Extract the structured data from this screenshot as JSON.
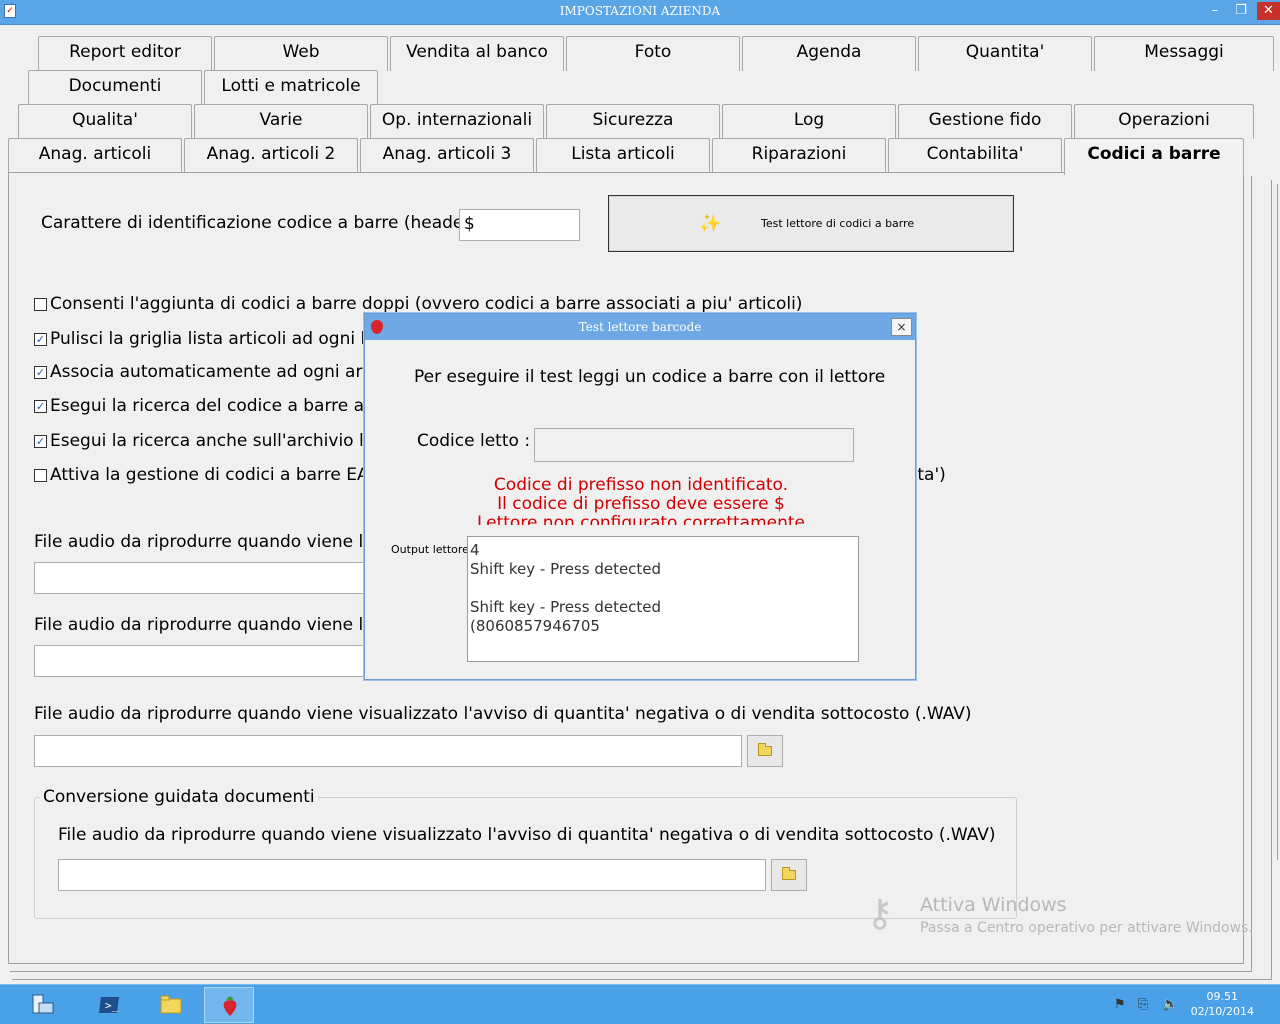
{
  "window": {
    "title": "IMPOSTAZIONI AZIENDA"
  },
  "tabs_row1": [
    "Report editor",
    "Web",
    "Vendita al banco",
    "Foto",
    "Agenda",
    "Quantita'",
    "Messaggi"
  ],
  "tabs_row2": [
    "Documenti",
    "Lotti e matricole"
  ],
  "tabs_row3": [
    "Qualita'",
    "Varie",
    "Op. internazionali",
    "Sicurezza",
    "Log",
    "Gestione fido",
    "Operazioni"
  ],
  "tabs_row4": [
    "Anag. articoli",
    "Anag. articoli 2",
    "Anag. articoli 3",
    "Lista articoli",
    "Riparazioni",
    "Contabilita'",
    "Codici a barre"
  ],
  "header_char": {
    "label": "Carattere di identificazione codice a barre (header) :",
    "value": "$"
  },
  "test_button": {
    "label": "Test lettore di codici a barre"
  },
  "checkboxes": [
    {
      "label": "Consenti l'aggiunta di codici a barre doppi (ovvero codici a barre associati a piu' articoli)",
      "checked": false
    },
    {
      "label": "Pulisci la griglia lista articoli ad ogni lettu",
      "checked": true
    },
    {
      "label": "Associa automaticamente ad ogni artico",
      "checked": true
    },
    {
      "label": "Esegui la ricerca del codice a barre anch",
      "checked": true
    },
    {
      "label": "Esegui la ricerca anche sull'archivio lotti/",
      "checked": true
    },
    {
      "label": "Attiva la gestione di codici a barre EAN c",
      "checked": false
    }
  ],
  "checkbox6_tail": "tita')",
  "audio1": {
    "label": "File audio da riprodurre quando viene letto",
    "value": ""
  },
  "audio2": {
    "label": "File audio da riprodurre quando viene letto",
    "value": ""
  },
  "audio3": {
    "label": "File audio da riprodurre quando viene visualizzato l'avviso di quantita' negativa o di vendita sottocosto (.WAV)",
    "value": ""
  },
  "group": {
    "title": "Conversione guidata documenti",
    "audio_label": "File audio da riprodurre quando viene visualizzato l'avviso di quantita' negativa o di vendita sottocosto (.WAV)",
    "audio_value": ""
  },
  "dialog": {
    "title": "Test lettore barcode",
    "close": "×",
    "instruction": "Per eseguire il test leggi un codice a barre con il lettore",
    "code_label": "Codice letto :",
    "code_value": "",
    "error1": "Codice di prefisso non identificato.",
    "error2": "Il codice di prefisso deve essere $",
    "error3": "Lettore non configurato correttamente",
    "output_label": "Output lettore :",
    "output_text": "4\nShift key - Press detected\n\nShift key - Press detected\n(8060857946705\n"
  },
  "watermark": {
    "line1": "Attiva Windows",
    "line2": "Passa a Centro operativo per attivare Windows."
  },
  "taskbar": {
    "items": [
      "server-manager-icon",
      "powershell-icon",
      "explorer-icon",
      "strawberry-app-icon"
    ],
    "time": "09.51",
    "date": "02/10/2014"
  },
  "colors": {
    "titlebar": "#5aa5e6",
    "taskbar": "#4aa1e8",
    "error": "#d00000"
  }
}
